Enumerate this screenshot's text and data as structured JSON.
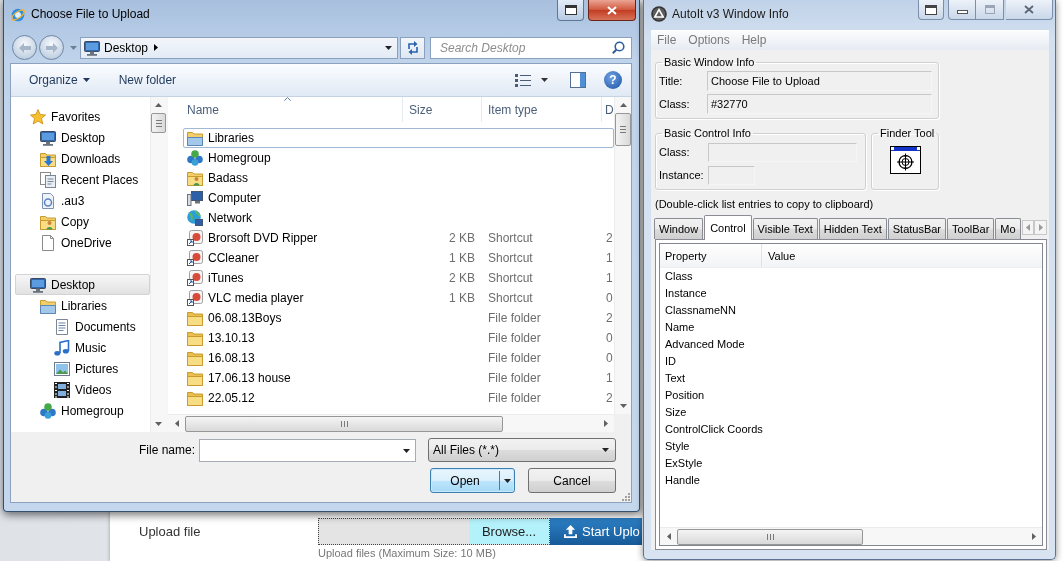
{
  "background_page": {
    "upload_label": "Upload file",
    "browse_button": "Browse...",
    "start_button": "Start Uplo",
    "note": "Upload files (Maximum Size: 10 MB)"
  },
  "file_dialog": {
    "title": "Choose File to Upload",
    "address": "Desktop",
    "search_placeholder": "Search Desktop",
    "toolbar": {
      "organize": "Organize",
      "new_folder": "New folder",
      "help": "?"
    },
    "nav": [
      {
        "label": "Favorites",
        "kind": "favorites",
        "selected": false,
        "children": [
          {
            "label": "Desktop",
            "kind": "desktop",
            "selected": false
          },
          {
            "label": "Downloads",
            "kind": "downloads",
            "selected": false
          },
          {
            "label": "Recent Places",
            "kind": "recent",
            "selected": false
          },
          {
            "label": ".au3",
            "kind": "script",
            "selected": false
          },
          {
            "label": "Copy",
            "kind": "profile",
            "selected": false
          },
          {
            "label": "OneDrive",
            "kind": "file",
            "selected": false
          }
        ]
      },
      {
        "label": "Desktop",
        "kind": "desktop",
        "selected": true,
        "children": [
          {
            "label": "Libraries",
            "kind": "libraries",
            "selected": false,
            "children": [
              {
                "label": "Documents",
                "kind": "documents",
                "selected": false
              },
              {
                "label": "Music",
                "kind": "music",
                "selected": false
              },
              {
                "label": "Pictures",
                "kind": "pictures",
                "selected": false
              },
              {
                "label": "Videos",
                "kind": "videos",
                "selected": false
              }
            ]
          },
          {
            "label": "Homegroup",
            "kind": "homegroup",
            "selected": false
          }
        ]
      }
    ],
    "columns": [
      {
        "label": "Name",
        "sorted": true
      },
      {
        "label": "Size",
        "sorted": false
      },
      {
        "label": "Item type",
        "sorted": false
      },
      {
        "label": "D",
        "sorted": false
      }
    ],
    "rows": [
      {
        "name": "Libraries",
        "kind": "libraries",
        "focused": true
      },
      {
        "name": "Homegroup",
        "kind": "homegroup",
        "focused": false
      },
      {
        "name": "Badass",
        "kind": "profile",
        "focused": false
      },
      {
        "name": "Computer",
        "kind": "computer",
        "focused": false
      },
      {
        "name": "Network",
        "kind": "network",
        "focused": false
      },
      {
        "name": "Brorsoft DVD Ripper",
        "kind": "shortcut",
        "size": "2 KB",
        "item_type": "Shortcut",
        "column_4": "2",
        "focused": false
      },
      {
        "name": "CCleaner",
        "kind": "shortcut",
        "size": "1 KB",
        "item_type": "Shortcut",
        "column_4": "1",
        "focused": false
      },
      {
        "name": "iTunes",
        "kind": "shortcut",
        "size": "2 KB",
        "item_type": "Shortcut",
        "column_4": "1",
        "focused": false
      },
      {
        "name": "VLC media player",
        "kind": "shortcut",
        "size": "1 KB",
        "item_type": "Shortcut",
        "column_4": "0",
        "focused": false
      },
      {
        "name": "06.08.13Boys",
        "kind": "folder",
        "item_type": "File folder",
        "column_4": "2",
        "focused": false
      },
      {
        "name": "13.10.13",
        "kind": "folder",
        "item_type": "File folder",
        "column_4": "0",
        "focused": false
      },
      {
        "name": "16.08.13",
        "kind": "folder",
        "item_type": "File folder",
        "column_4": "0",
        "focused": false
      },
      {
        "name": "17.06.13 house",
        "kind": "folder",
        "item_type": "File folder",
        "column_4": "1",
        "focused": false
      },
      {
        "name": "22.05.12",
        "kind": "folder",
        "item_type": "File folder",
        "column_4": "2",
        "focused": false
      }
    ],
    "file_name": {
      "label": "File name:"
    },
    "file_type": "All Files (*.*)",
    "open_button": {
      "label": "Open",
      "default": true
    },
    "cancel_button": {
      "label": "Cancel",
      "default": false
    }
  },
  "autoit_window": {
    "title": "AutoIt v3 Window Info",
    "menu": [
      "File",
      "Options",
      "Help"
    ],
    "window_group": {
      "heading": "Basic Window Info",
      "fields": [
        {
          "label": "Title:",
          "value": "Choose File to Upload"
        },
        {
          "label": "Class:",
          "value": "#32770"
        }
      ]
    },
    "control_group": {
      "heading": "Basic Control Info",
      "fields": [
        {
          "label": "Class:"
        },
        {
          "label": "Instance:"
        }
      ]
    },
    "finder_heading": "Finder Tool",
    "hint": "(Double-click list entries to copy to clipboard)",
    "tabs": [
      {
        "label": "Window",
        "selected": false
      },
      {
        "label": "Control",
        "selected": true
      },
      {
        "label": "Visible Text",
        "selected": false
      },
      {
        "label": "Hidden Text",
        "selected": false
      },
      {
        "label": "StatusBar",
        "selected": false
      },
      {
        "label": "ToolBar",
        "selected": false
      },
      {
        "label": "Mo",
        "selected": false
      }
    ],
    "columns": [
      "Property",
      "Value"
    ],
    "properties": [
      "Class",
      "Instance",
      "ClassnameNN",
      "Name",
      "Advanced Mode",
      "ID",
      "Text",
      "Position",
      "Size",
      "ControlClick Coords",
      "Style",
      "ExStyle",
      "Handle"
    ]
  }
}
